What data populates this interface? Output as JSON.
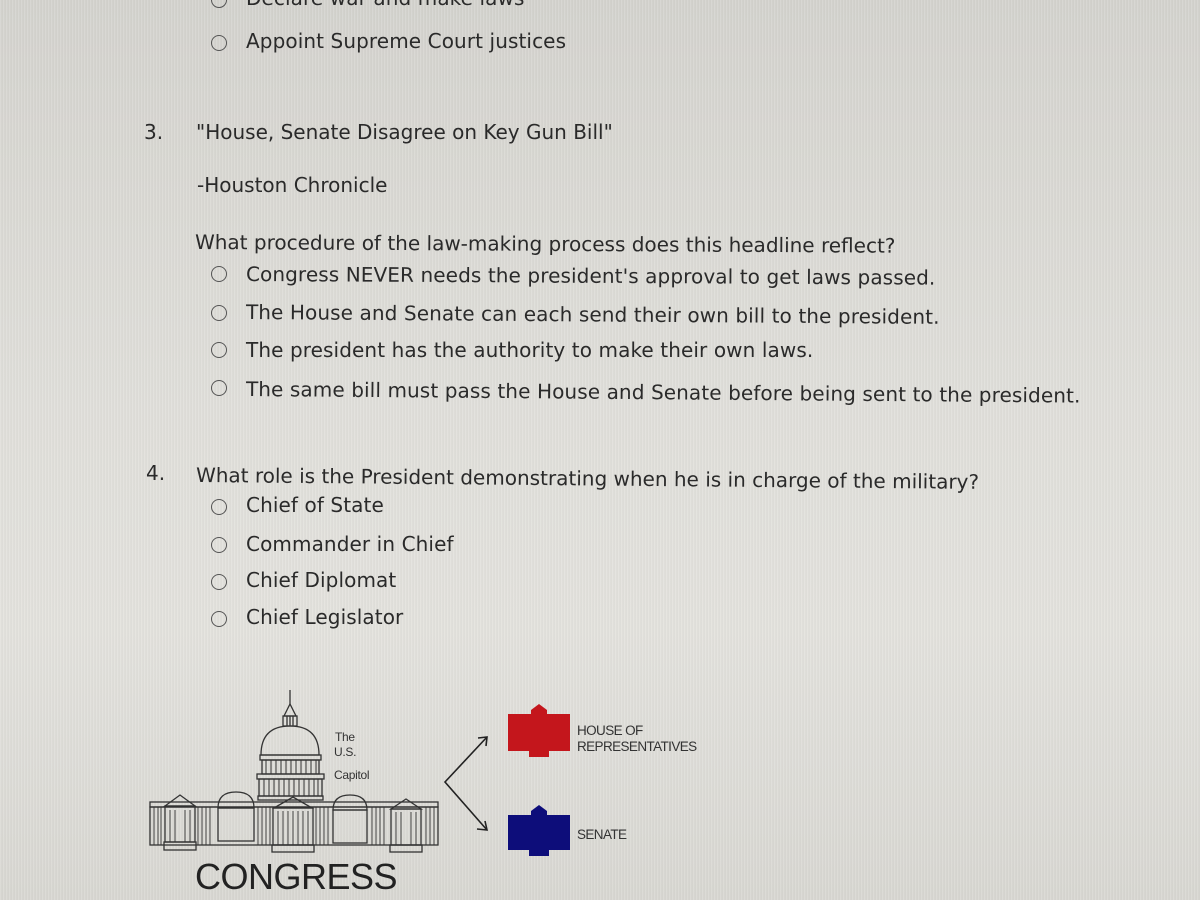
{
  "question_2_tail": {
    "options": [
      {
        "label": "Declare war and make laws"
      },
      {
        "label": "Appoint Supreme Court justices"
      }
    ]
  },
  "question_3": {
    "number": "3.",
    "headline": "\"House, Senate Disagree on Key Gun Bill\"",
    "source": "-Houston Chronicle",
    "prompt": "What procedure of the law-making process does this headline reflect?",
    "options": [
      {
        "label": "Congress NEVER needs the president's approval to get laws passed."
      },
      {
        "label": "The House and Senate can each send their own bill to the president."
      },
      {
        "label": "The president has the authority to make their own laws."
      },
      {
        "label": "The same bill must pass the House and Senate before being sent to the president."
      }
    ]
  },
  "question_4": {
    "number": "4.",
    "prompt": "What role is the President demonstrating when he is in charge of the military?",
    "options": [
      {
        "label": "Chief of State"
      },
      {
        "label": "Commander in Chief"
      },
      {
        "label": "Chief Diplomat"
      },
      {
        "label": "Chief Legislator"
      }
    ]
  },
  "diagram": {
    "capitol_caption": [
      "The",
      "U.S.",
      "Capitol"
    ],
    "title": "CONGRESS",
    "branches": [
      {
        "label_lines": [
          "HOUSE OF",
          "REPRESENTATIVES"
        ],
        "color": "#c4161c"
      },
      {
        "label_lines": [
          "SENATE"
        ],
        "color": "#0d0d7a"
      }
    ]
  }
}
